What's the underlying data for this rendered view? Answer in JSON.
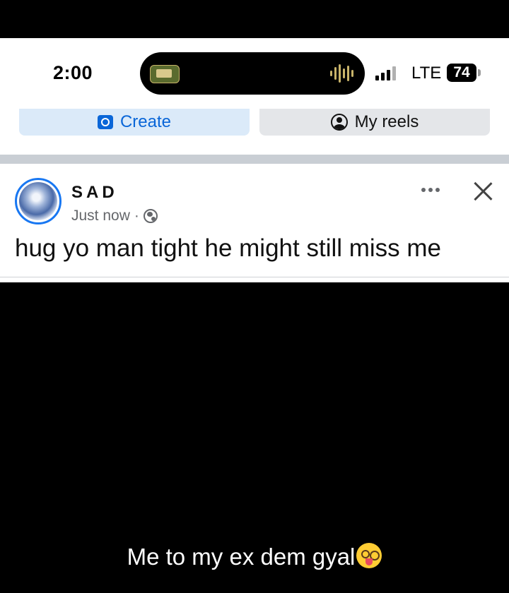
{
  "status_bar": {
    "time": "2:00",
    "network": "LTE",
    "battery": "74"
  },
  "tabs": {
    "create_label": "Create",
    "my_reels_label": "My reels"
  },
  "post": {
    "author": "SAD",
    "timestamp": "Just now",
    "separator": "·",
    "privacy_icon": "globe-icon",
    "text": "hug yo man tight he might still miss me"
  },
  "caption": {
    "text": "Me to my ex dem gyal",
    "emoji": "woozy-face"
  },
  "colors": {
    "accent": "#0a66d8",
    "avatar_ring": "#1877f2",
    "meta_gray": "#65676b"
  }
}
